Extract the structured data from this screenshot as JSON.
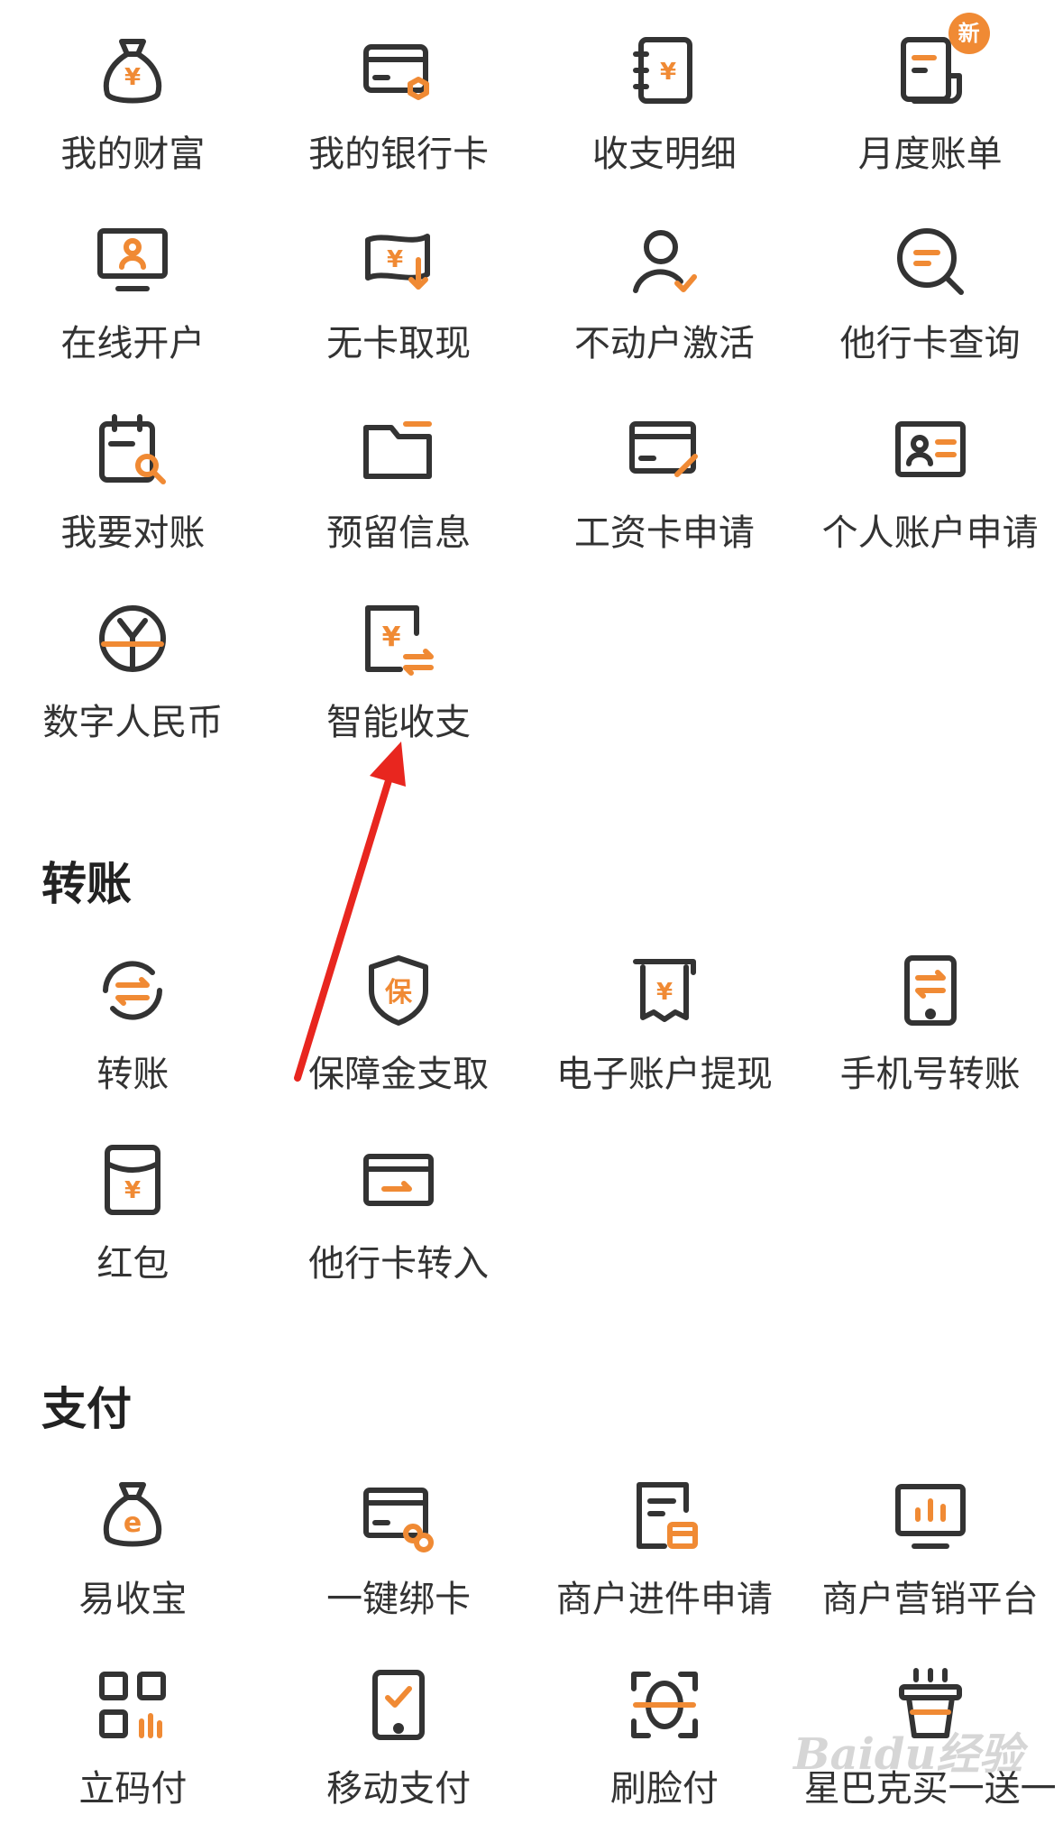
{
  "accent_color": "#f08a34",
  "icon_color": "#333333",
  "arrow_color": "#e8261f",
  "account_items": [
    {
      "label": "我的财富",
      "icon": "money-bag-icon"
    },
    {
      "label": "我的银行卡",
      "icon": "bank-card-icon"
    },
    {
      "label": "收支明细",
      "icon": "ledger-icon"
    },
    {
      "label": "月度账单",
      "icon": "bill-icon",
      "badge": "新"
    },
    {
      "label": "在线开户",
      "icon": "monitor-person-icon"
    },
    {
      "label": "无卡取现",
      "icon": "cash-withdraw-icon"
    },
    {
      "label": "不动户激活",
      "icon": "user-check-icon"
    },
    {
      "label": "他行卡查询",
      "icon": "search-chat-icon"
    },
    {
      "label": "我要对账",
      "icon": "calendar-search-icon"
    },
    {
      "label": "预留信息",
      "icon": "folder-icon"
    },
    {
      "label": "工资卡申请",
      "icon": "card-edit-icon"
    },
    {
      "label": "个人账户申请",
      "icon": "id-card-icon"
    },
    {
      "label": "数字人民币",
      "icon": "digital-rmb-icon"
    },
    {
      "label": "智能收支",
      "icon": "smart-transfer-icon"
    }
  ],
  "transfer": {
    "title": "转账",
    "items": [
      {
        "label": "转账",
        "icon": "transfer-cycle-icon"
      },
      {
        "label": "保障金支取",
        "icon": "shield-bao-icon"
      },
      {
        "label": "电子账户提现",
        "icon": "atm-receipt-icon"
      },
      {
        "label": "手机号转账",
        "icon": "phone-transfer-icon"
      },
      {
        "label": "红包",
        "icon": "red-packet-icon"
      },
      {
        "label": "他行卡转入",
        "icon": "card-transfer-in-icon"
      }
    ]
  },
  "payment": {
    "title": "支付",
    "items": [
      {
        "label": "易收宝",
        "icon": "e-bag-icon"
      },
      {
        "label": "一键绑卡",
        "icon": "card-link-icon"
      },
      {
        "label": "商户进件申请",
        "icon": "merchant-doc-icon"
      },
      {
        "label": "商户营销平台",
        "icon": "chart-monitor-icon"
      },
      {
        "label": "立码付",
        "icon": "qr-grid-icon"
      },
      {
        "label": "移动支付",
        "icon": "mobile-pay-icon"
      },
      {
        "label": "刷脸付",
        "icon": "face-scan-icon"
      },
      {
        "label": "星巴克买一送一",
        "icon": "coffee-cup-icon"
      }
    ]
  },
  "watermark": "Baidu经验"
}
